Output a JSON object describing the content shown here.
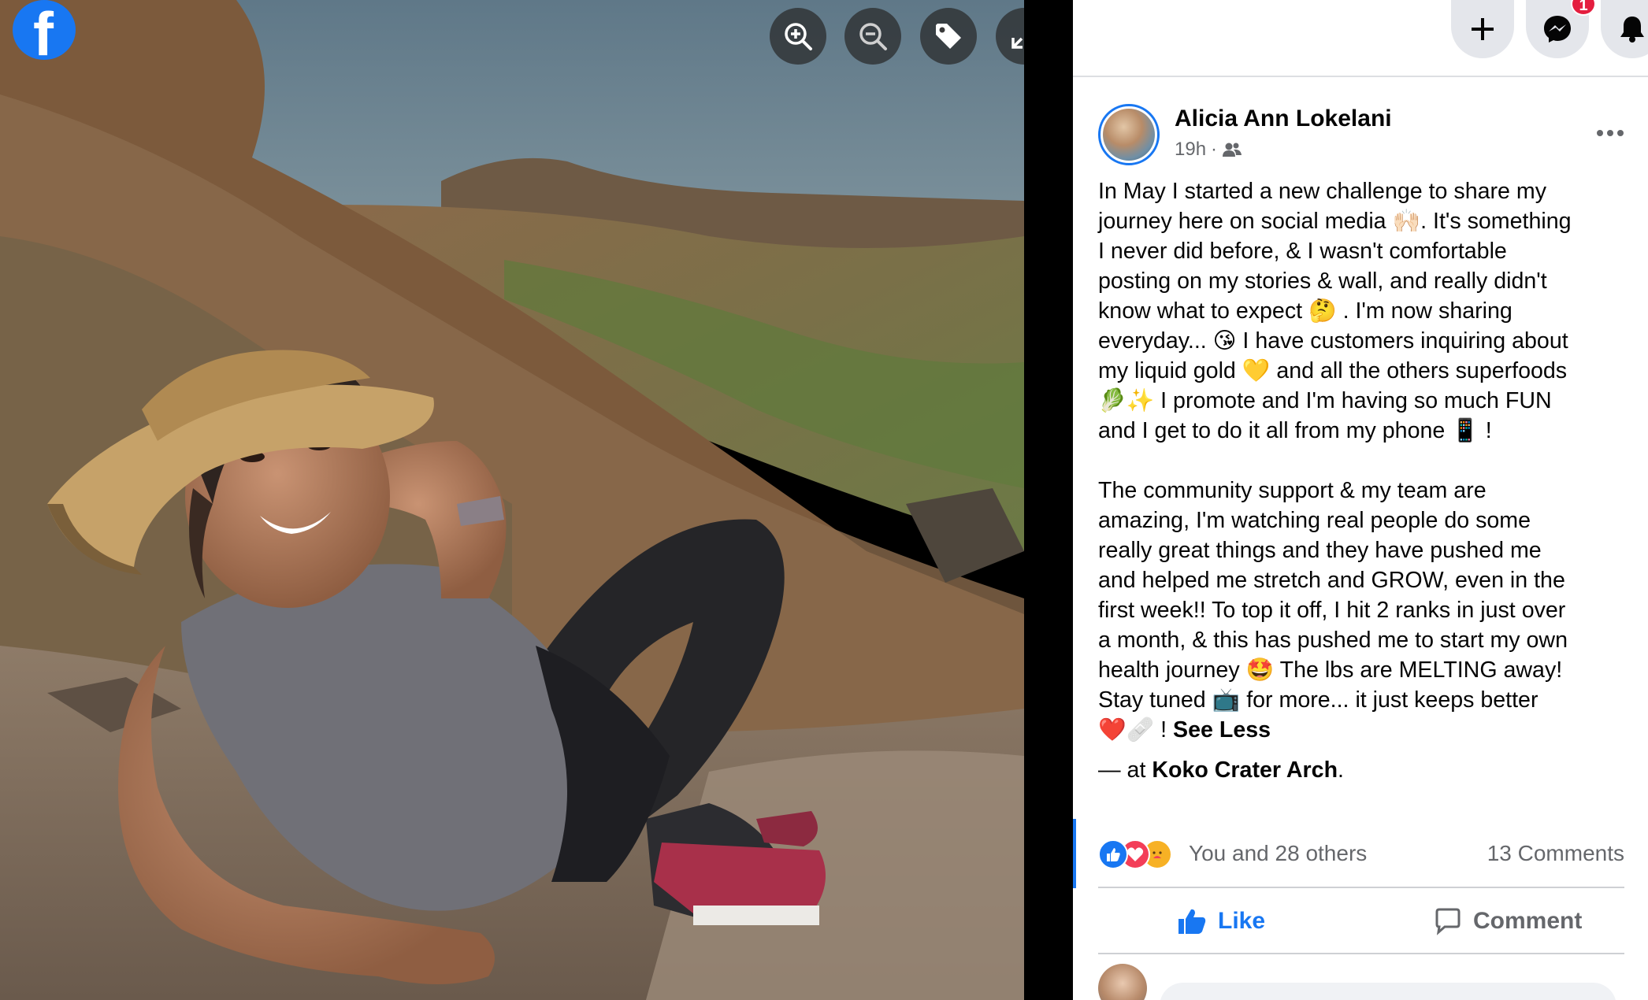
{
  "viewer": {
    "logo_letter": "f",
    "buttons": [
      "zoom-in",
      "zoom-out",
      "tag",
      "fullscreen"
    ]
  },
  "topbar": {
    "messenger_badge": "1",
    "icons": [
      "plus-icon",
      "messenger-icon",
      "bell-icon"
    ]
  },
  "post": {
    "author": "Alicia Ann Lokelani",
    "time": "19h",
    "separator": "·",
    "audience_icon": "friends-icon",
    "paragraph1": [
      "In May I started a new challenge to share my",
      "journey here on social media 🙌🏻. It's something",
      "I never did before, & I wasn't comfortable",
      "posting on my stories & wall, and really didn't",
      "know what to expect 🤔 . I'm now sharing",
      "everyday... 😘 I have customers inquiring about",
      "my liquid gold 💛 and all the others superfoods",
      "🥬✨ I promote and I'm having so much FUN",
      "and I get to do it all from my phone 📱 !"
    ],
    "paragraph2": [
      "The community support & my team are",
      "amazing, I'm watching real people do some",
      "really great things and they have pushed me",
      "and helped me stretch and GROW, even in the",
      "first week!! To top it off, I hit 2 ranks in just over",
      "a month, & this has pushed me to start my own",
      "health journey 🤩 The lbs are MELTING away!",
      "Stay tuned 📺 for more... it just keeps better"
    ],
    "last_line_prefix": "❤️🩹 ! ",
    "see_less": "See Less",
    "location_prefix": "— at ",
    "location_name": "Koko Crater Arch",
    "location_suffix": "."
  },
  "reactions": {
    "types": [
      "like",
      "love",
      "care"
    ],
    "count_text": "You and 28 others",
    "comments_text": "13 Comments",
    "colors": {
      "like": "#1877f2",
      "love": "#f33e58",
      "care": "#f7b125"
    }
  },
  "actions": {
    "like": "Like",
    "comment": "Comment"
  },
  "colors": {
    "brand": "#1877f2",
    "secondary_text": "#65676b",
    "badge": "#e41e3f"
  }
}
